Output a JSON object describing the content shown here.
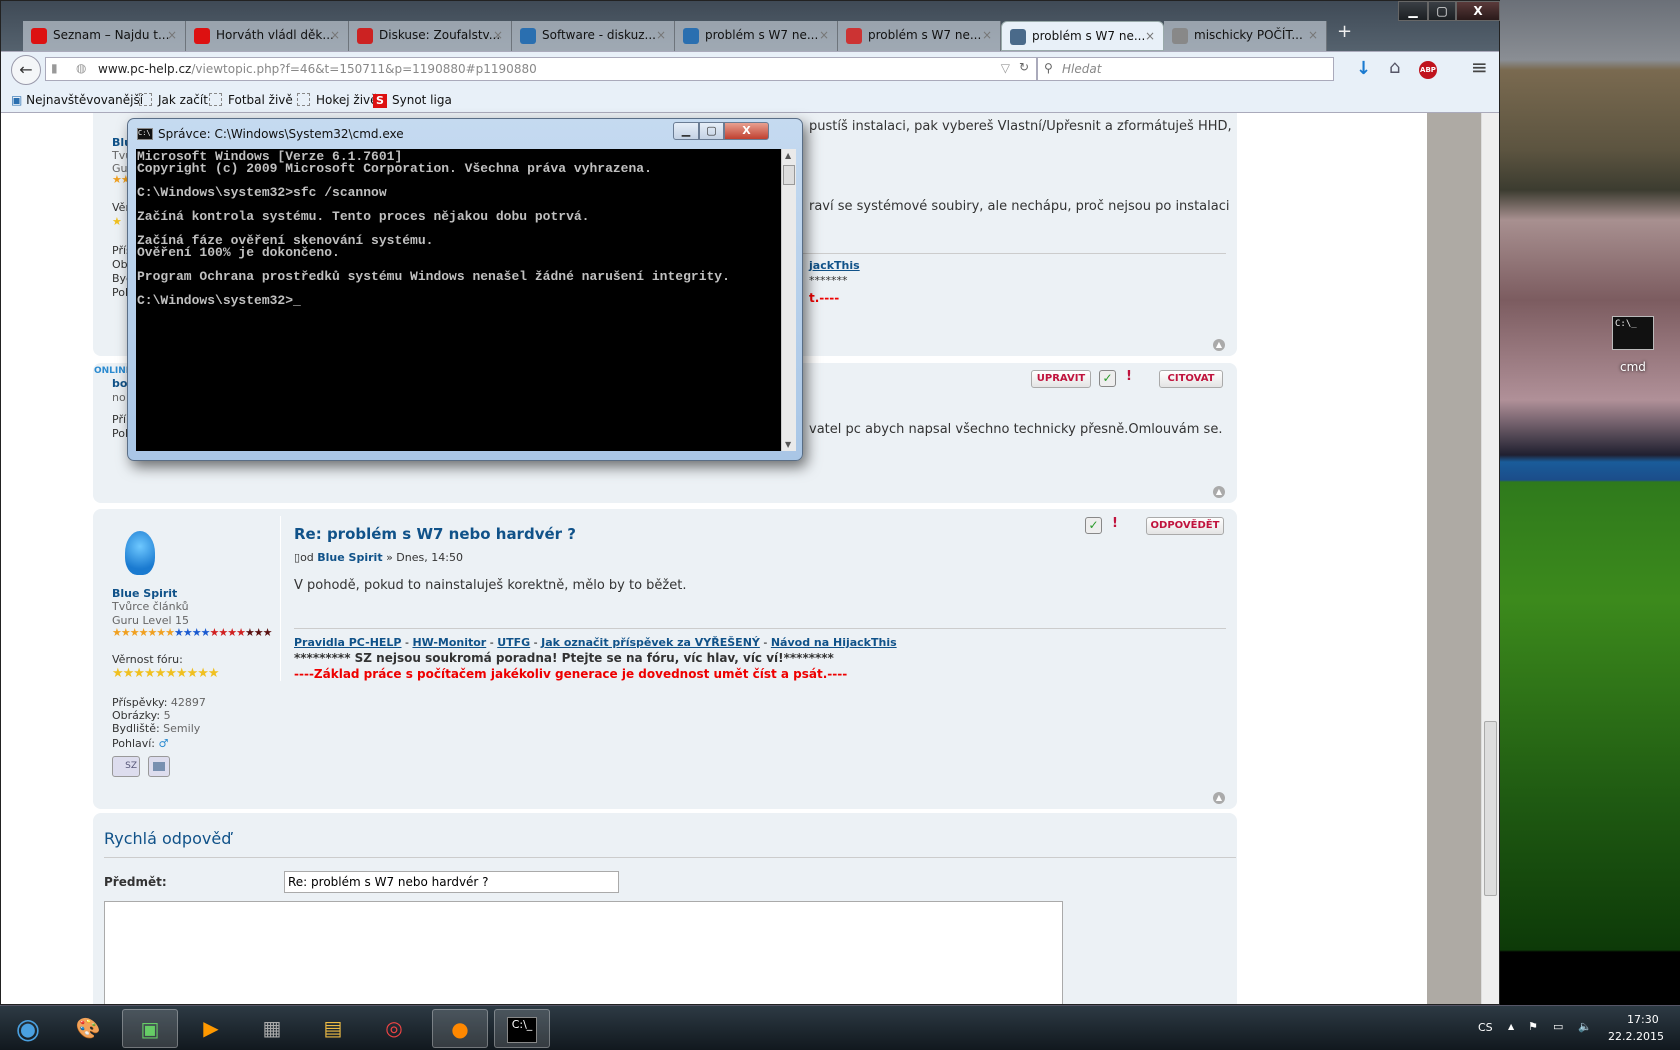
{
  "window_controls": {
    "minimize": "▁",
    "maximize": "▢",
    "close": "X"
  },
  "tabs": [
    {
      "label": "Seznam – Najdu t...",
      "icon": "seznam-icon",
      "color": "#d11"
    },
    {
      "label": "Horváth vládl děk...",
      "icon": "sport-s-icon",
      "color": "#d11"
    },
    {
      "label": "Diskuse: Zoufalstv...",
      "icon": "idnes-icon",
      "color": "#c22"
    },
    {
      "label": "Software - diskuz...",
      "icon": "pc-icon",
      "color": "#2a6fb0"
    },
    {
      "label": "problém s W7 ne...",
      "icon": "pc-icon",
      "color": "#2a6fb0"
    },
    {
      "label": "problém s W7 ne...",
      "icon": "zive-icon",
      "color": "#c33"
    },
    {
      "label": "problém s W7 ne...",
      "icon": "computer-icon",
      "color": "#4a6a8a"
    },
    {
      "label": "mischicky POČÍT...",
      "icon": "mischicky-icon",
      "color": "#888"
    }
  ],
  "tab_close": "×",
  "new_tab": "+",
  "nav": {
    "url_domain": "www.pc-help.cz",
    "url_path": "/viewtopic.php?f=46&t=150711&p=1190880#p1190880",
    "search_placeholder": "Hledat",
    "abp": "ABP"
  },
  "bookmarks": [
    "Nejnavštěvovanější",
    "Jak začít",
    "Fotbal živě",
    "Hokej živě",
    "Synot liga"
  ],
  "post1": {
    "side": [
      "Blue Spirit",
      "Tvůrce článků",
      "Guru Level 15",
      "Věrnost fóru:",
      "Příspěvky:",
      "Obrázky:",
      "Bydliště:",
      "Pohlaví:"
    ],
    "line1": "pustíš instalaci, pak vybereš Vlastní/Upřesnit a zformátuješ HHD,",
    "line2": "raví se systémové soubiry, ale nechápu, proč nejsou po instalaci",
    "sig_link": "jackThis",
    "sig_stars": "*******",
    "sig_red": "t.----"
  },
  "post2": {
    "online": "ONLINE",
    "side": [
      "bo",
      "no",
      "Pří",
      "Pol"
    ],
    "edit": "UPRAVIT",
    "quote": "CITOVAT",
    "text": "vatel pc abych napsal všechno technicky přesně.Omlouvám se."
  },
  "post3": {
    "title": "Re: problém s W7 nebo hardvér ?",
    "by_prefix": "od",
    "author": "Blue Spirit",
    "date": "» Dnes, 14:50",
    "body": "V pohodě, pokud to nainstaluješ korektně, mělo by to běžet.",
    "reply": "ODPOVĚDĚT",
    "username": "Blue Spirit",
    "rank": "Tvůrce článků",
    "level": "Guru Level 15",
    "loyalty": "Věrnost fóru:",
    "stats": [
      {
        "k": "Příspěvky:",
        "v": "42897"
      },
      {
        "k": "Obrázky:",
        "v": "5"
      },
      {
        "k": "Bydliště:",
        "v": "Semily"
      },
      {
        "k": "Pohlaví:",
        "v": "♂"
      }
    ],
    "pm": "SZ",
    "links": [
      "Pravidla PC-HELP",
      "HW-Monitor",
      "UTFG",
      "Jak označit příspěvek za VYŘEŠENÝ",
      "Návod na HijackThis"
    ],
    "sig_line": "********* SZ nejsou soukromá poradna! Ptejte se na fóru, víc hlav, víc ví!********",
    "sig_red": "----Základ práce s počítačem jakékoliv generace je dovednost umět číst a psát.----"
  },
  "quick_reply": {
    "title": "Rychlá odpověď",
    "subject_label": "Předmět:",
    "subject_value": "Re: problém s W7 nebo hardvér ?",
    "message": ""
  },
  "cmd": {
    "title": "Správce: C:\\Windows\\System32\\cmd.exe",
    "lines": [
      "Microsoft Windows [Verze 6.1.7601]",
      "Copyright (c) 2009 Microsoft Corporation. Všechna práva vyhrazena.",
      "",
      "C:\\Windows\\system32>sfc /scannow",
      "",
      "Začíná kontrola systému. Tento proces nějakou dobu potrvá.",
      "",
      "Začíná fáze ověření skenování systému.",
      "Ověření 100% je dokončeno.",
      "",
      "Program Ochrana prostředků systému Windows nenašel žádné narušení integrity.",
      "",
      "C:\\Windows\\system32>_"
    ]
  },
  "desktop": {
    "shortcut": "cmd",
    "shortcut_icon_text": "C:\\_"
  },
  "tray": {
    "lang": "CS",
    "time": "17:30",
    "date": "22.2.2015"
  }
}
